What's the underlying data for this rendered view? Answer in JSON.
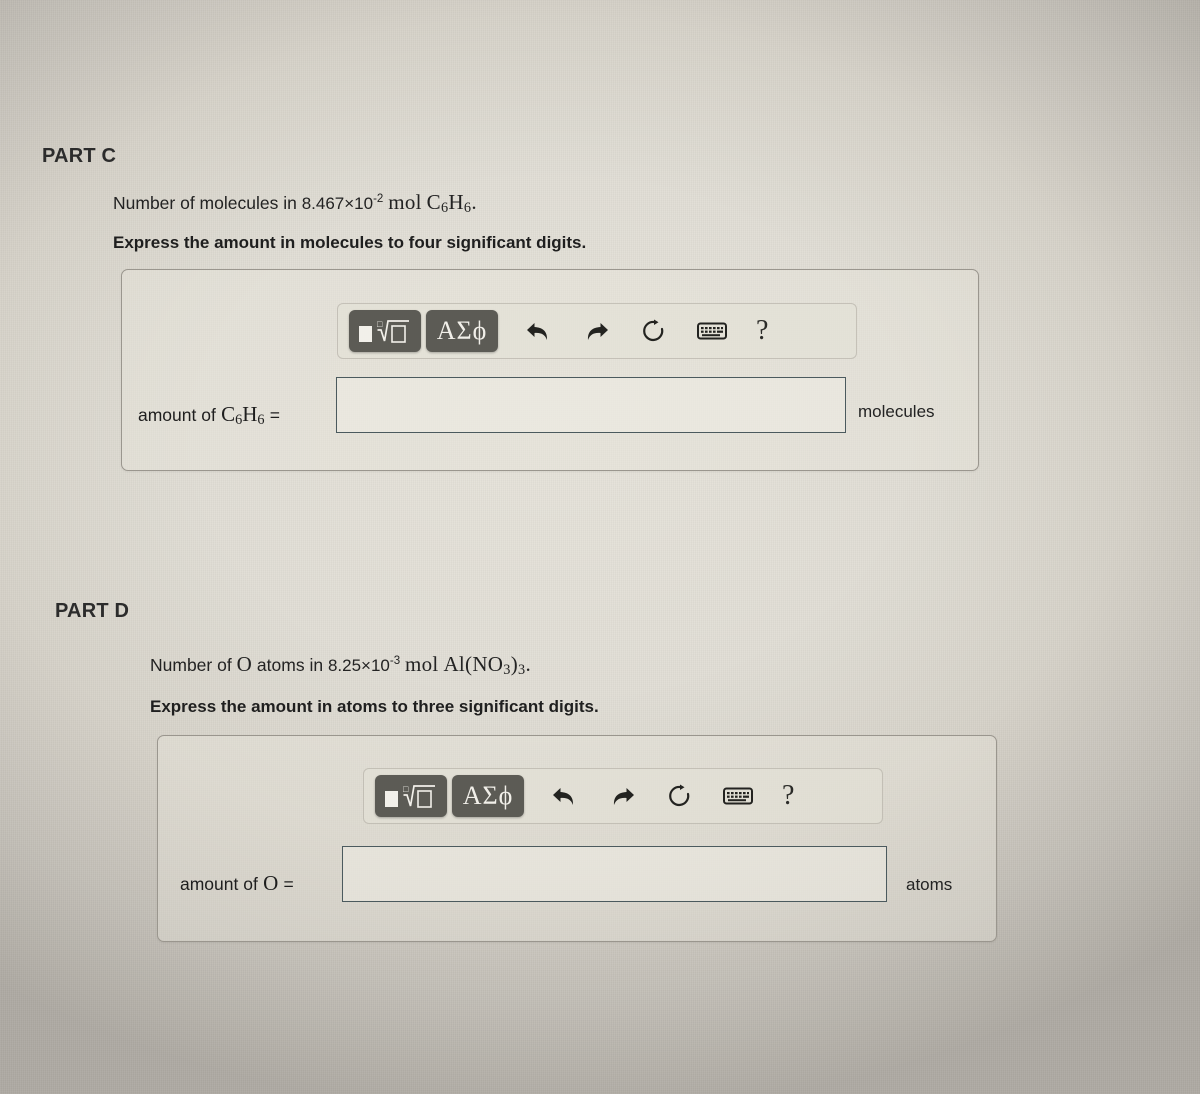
{
  "partC": {
    "label": "PART C",
    "prompt_prefix": "Number of molecules in",
    "prompt_value": "8.467×10",
    "prompt_exponent": "-2",
    "prompt_unit": "mol",
    "prompt_formula_c": "C",
    "prompt_formula_c_sub": "6",
    "prompt_formula_h": "H",
    "prompt_formula_h_sub": "6",
    "prompt_period": ".",
    "instruction": "Express the amount in molecules to four significant digits.",
    "answer_label_prefix": "amount of",
    "answer_label_formula_c": "C",
    "answer_label_formula_c_sub": "6",
    "answer_label_formula_h": "H",
    "answer_label_formula_h_sub": "6",
    "answer_label_equals": "=",
    "input_value": "",
    "input_placeholder": "",
    "unit": "molecules"
  },
  "partD": {
    "label": "PART D",
    "prompt_prefix": "Number of",
    "prompt_species": "O",
    "prompt_middle": "atoms in",
    "prompt_value": "8.25×10",
    "prompt_exponent": "-3",
    "prompt_unit": "mol",
    "prompt_formula_al": "Al(NO",
    "prompt_formula_sub1": "3",
    "prompt_formula_close": ")",
    "prompt_formula_sub2": "3",
    "prompt_period": ".",
    "instruction": "Express the amount in atoms to three significant digits.",
    "answer_label_prefix": "amount of",
    "answer_label_species": "O",
    "answer_label_equals": "=",
    "input_value": "",
    "input_placeholder": "",
    "unit": "atoms"
  },
  "toolbar": {
    "math_template_button": "math-template",
    "greek_button": "ΑΣϕ",
    "undo": "undo",
    "redo": "redo",
    "reset": "reset",
    "keyboard": "keyboard",
    "help": "?"
  },
  "colors": {
    "page_bg": "#e1ded5",
    "button_dark": "#5c5b55",
    "input_border": "#4b5a5e",
    "panel_border": "#9a968e",
    "text": "#232323"
  }
}
